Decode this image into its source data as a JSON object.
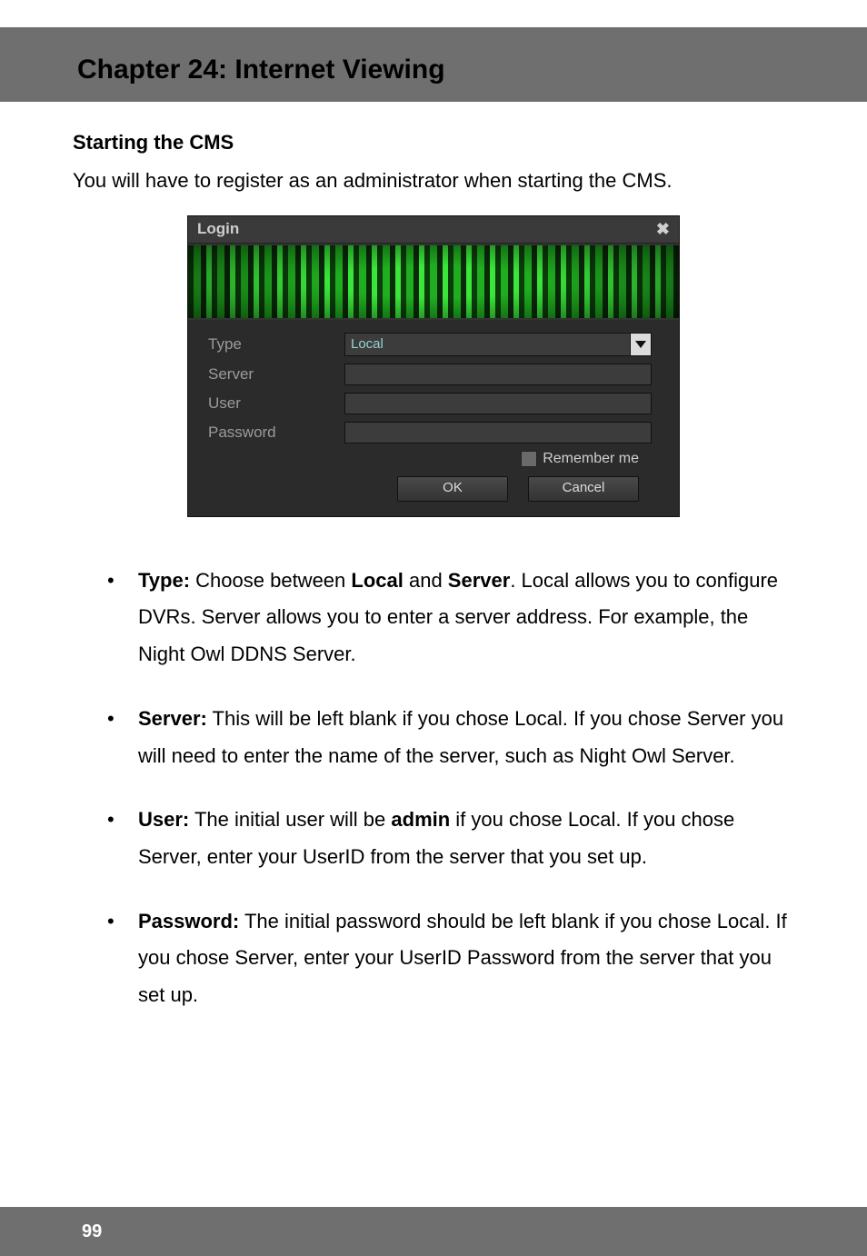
{
  "header": {
    "title": "Chapter 24: Internet Viewing"
  },
  "section": {
    "heading": "Starting the CMS"
  },
  "intro": "You will have to register as an administrator when starting the CMS.",
  "login_dialog": {
    "title": "Login",
    "close_glyph": "✖",
    "labels": {
      "type": "Type",
      "server": "Server",
      "user": "User",
      "password": "Password"
    },
    "values": {
      "type_selected": "Local",
      "server": "",
      "user": "",
      "password": ""
    },
    "remember_label": "Remember me",
    "buttons": {
      "ok": "OK",
      "cancel": "Cancel"
    }
  },
  "bullets": {
    "type": {
      "lead": "Type:",
      "t1": " Choose between ",
      "b1": "Local",
      "t2": " and ",
      "b2": "Server",
      "t3": ". Local allows you to configure DVRs. Server allows you to enter a server address. For example, the Night Owl DDNS Server."
    },
    "server": {
      "lead": "Server:",
      "t1": " This will be left blank if you chose Local. If you chose Server you will need to enter the name of the server, such as Night Owl Server."
    },
    "user": {
      "lead": "User:",
      "t1": " The initial user will be ",
      "b1": "admin",
      "t2": " if you chose Local. If you chose Server, enter your UserID from the server that you set up."
    },
    "password": {
      "lead": "Password:",
      "t1": " The initial password should be left blank if you chose Local. If you chose Server, enter your UserID Password from the server that you set up."
    }
  },
  "footer": {
    "page_number": "99"
  }
}
